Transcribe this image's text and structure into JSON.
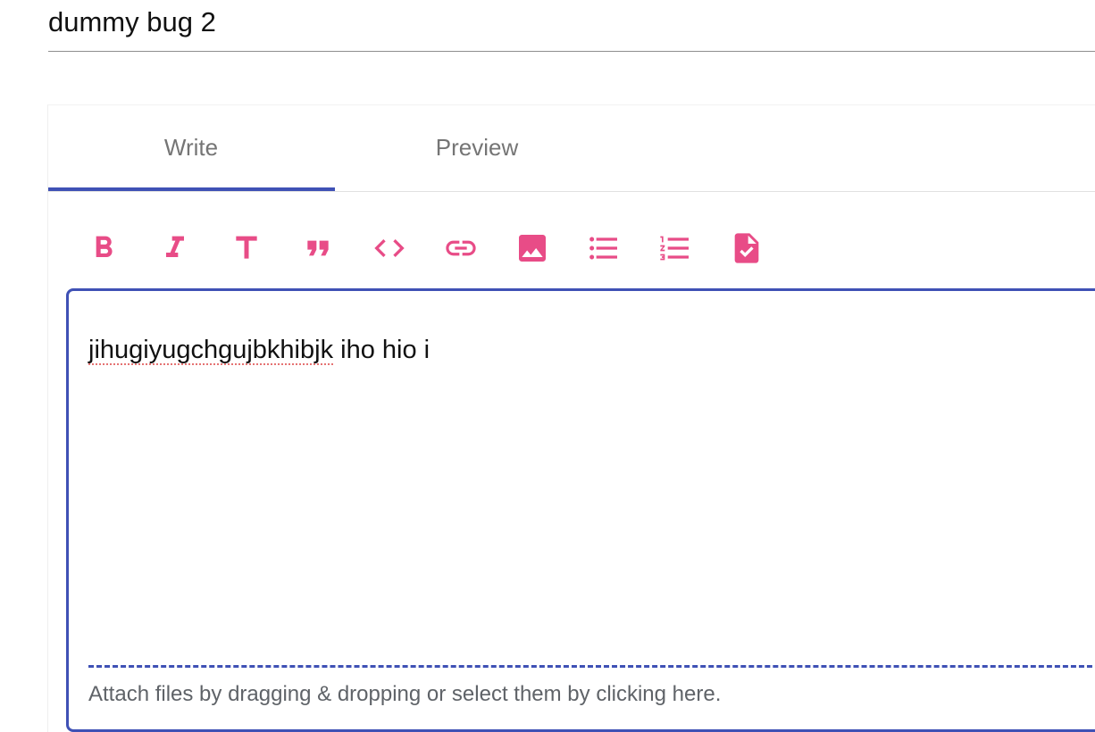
{
  "issue": {
    "title": "dummy bug 2"
  },
  "tabs": [
    {
      "label": "Write",
      "active": true
    },
    {
      "label": "Preview",
      "active": false
    }
  ],
  "toolbar": {
    "color": "#e84c87",
    "icons": [
      "bold-icon",
      "italic-icon",
      "heading-icon",
      "quote-icon",
      "code-icon",
      "link-icon",
      "image-icon",
      "bulleted-list-icon",
      "numbered-list-icon",
      "task-list-icon"
    ]
  },
  "editor": {
    "misspelled_word": "jihugiyugchgujbkhibjk",
    "rest_text": " iho hio i",
    "attach_hint": "Attach files by dragging & dropping or select them by clicking here."
  },
  "colors": {
    "accent": "#3f51b5",
    "icon": "#e84c87"
  }
}
